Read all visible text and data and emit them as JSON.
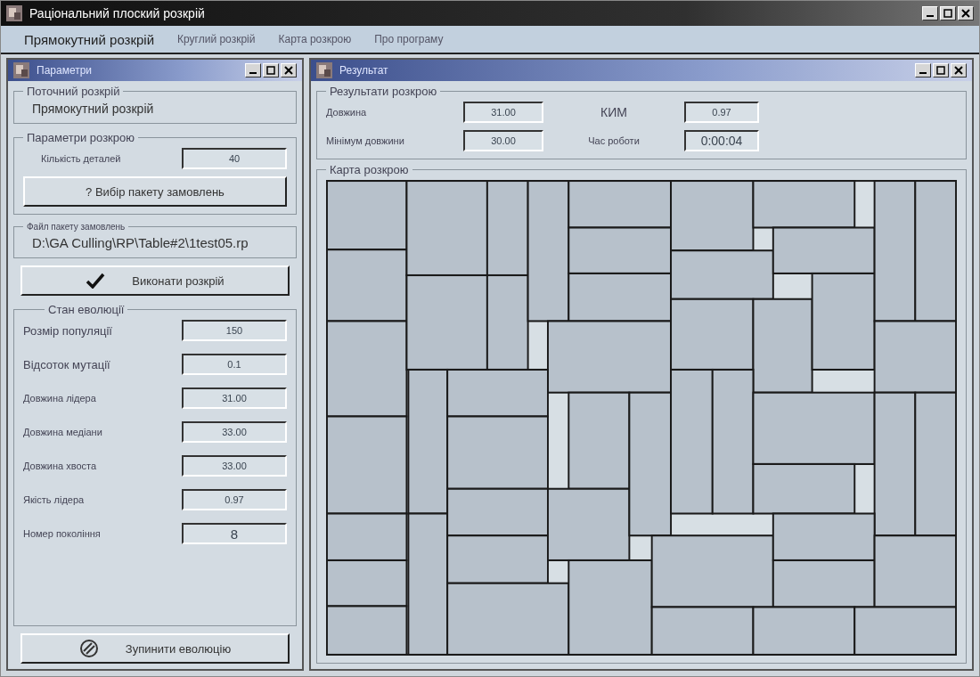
{
  "window": {
    "title": "Раціональний плоский розкрій"
  },
  "menu": [
    {
      "label": "Прямокутний розкрій",
      "selected": true
    },
    {
      "label": "Круглий розкрій",
      "selected": false
    },
    {
      "label": "Карта розкрою",
      "selected": false
    },
    {
      "label": "Про програму",
      "selected": false
    }
  ],
  "params_window": {
    "title": "Параметри",
    "current_cut": {
      "legend": "Поточний розкрій",
      "value": "Прямокутний розкрій"
    },
    "cut_parameters": {
      "legend": "Параметри розкрою",
      "fields": [
        {
          "label": "Кількість деталей",
          "value": "40"
        }
      ],
      "button": "? Вибір пакету замовлень"
    },
    "order_file": {
      "legend": "Файл пакету замовлень",
      "value": "D:\\GA Culling\\RP\\Table#2\\1test05.rp"
    },
    "run_button": "Виконати розкрій",
    "evolution": {
      "legend": "Стан еволюції",
      "fields": [
        {
          "label": "Розмір популяції",
          "value": "150"
        },
        {
          "label": "Відсоток мутації",
          "value": "0.1"
        },
        {
          "label": "Довжина лідера",
          "value": "31.00"
        },
        {
          "label": "Довжина медіани",
          "value": "33.00"
        },
        {
          "label": "Довжина хвоста",
          "value": "33.00"
        },
        {
          "label": "Якість лідера",
          "value": "0.97"
        },
        {
          "label": "Номер покоління",
          "value": "8"
        }
      ],
      "stop_button": "Зупинити еволюцію"
    }
  },
  "result_window": {
    "title": "Результат",
    "results": {
      "legend": "Результати розкрою",
      "fields": [
        {
          "label": "Довжина",
          "value": "31.00"
        },
        {
          "label": "КИМ",
          "value": "0.97"
        },
        {
          "label": "Мінімум довжини",
          "value": "30.00"
        },
        {
          "label": "Час роботи",
          "value": "0:00:04"
        }
      ]
    },
    "map": {
      "legend": "Карта розкрою"
    }
  }
}
